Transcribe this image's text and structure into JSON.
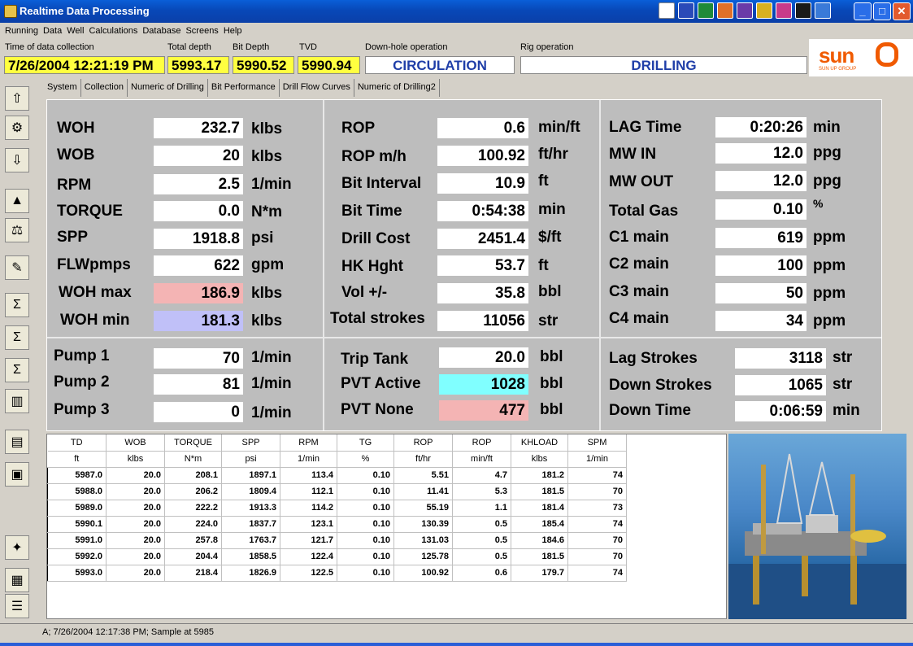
{
  "app": {
    "title": "Realtime Data Processing"
  },
  "menu": [
    "Running",
    "Data",
    "Well",
    "Calculations",
    "Database",
    "Screens",
    "Help"
  ],
  "header": {
    "time_label": "Time of data collection",
    "time_value": "7/26/2004 12:21:19 PM",
    "total_depth_label": "Total depth",
    "total_depth_value": "5993.17",
    "bit_depth_label": "Bit Depth",
    "bit_depth_value": "5990.52",
    "tvd_label": "TVD",
    "tvd_value": "5990.94",
    "downhole_label": "Down-hole operation",
    "downhole_value": "CIRCULATION",
    "rig_label": "Rig operation",
    "rig_value": "DRILLING"
  },
  "logo": {
    "text": "sun",
    "sub": "SUN UP GROUP"
  },
  "tabs": [
    "System",
    "Collection",
    "Numeric of Drilling",
    "Bit Performance",
    "Drill Flow Curves",
    "Numeric of Drilling2"
  ],
  "col1": [
    {
      "label": "WOH",
      "value": "232.7",
      "unit": "klbs"
    },
    {
      "label": "WOB",
      "value": "20",
      "unit": "klbs"
    },
    {
      "label": "RPM",
      "value": "2.5",
      "unit": "1/min"
    },
    {
      "label": "TORQUE",
      "value": "0.0",
      "unit": "N*m"
    },
    {
      "label": "SPP",
      "value": "1918.8",
      "unit": "psi"
    },
    {
      "label": "FLWpmps",
      "value": "622",
      "unit": "gpm"
    },
    {
      "label": "WOH max",
      "value": "186.9",
      "unit": "klbs"
    },
    {
      "label": "WOH min",
      "value": "181.3",
      "unit": "klbs"
    }
  ],
  "col2": [
    {
      "label": "ROP",
      "value": "0.6",
      "unit": "min/ft"
    },
    {
      "label": "ROP m/h",
      "value": "100.92",
      "unit": "ft/hr"
    },
    {
      "label": "Bit Interval",
      "value": "10.9",
      "unit": "ft"
    },
    {
      "label": "Bit Time",
      "value": "0:54:38",
      "unit": "min"
    },
    {
      "label": "Drill Cost",
      "value": "2451.4",
      "unit": "$/ft"
    },
    {
      "label": "HK Hght",
      "value": "53.7",
      "unit": "ft"
    },
    {
      "label": "Vol +/-",
      "value": "35.8",
      "unit": "bbl"
    },
    {
      "label": "Total strokes",
      "value": "11056",
      "unit": "str"
    }
  ],
  "col3": [
    {
      "label": "LAG Time",
      "value": "0:20:26",
      "unit": "min"
    },
    {
      "label": "MW IN",
      "value": "12.0",
      "unit": "ppg"
    },
    {
      "label": "MW OUT",
      "value": "12.0",
      "unit": "ppg"
    },
    {
      "label": "Total Gas",
      "value": "0.10",
      "unit": "%"
    },
    {
      "label": "C1 main",
      "value": "619",
      "unit": "ppm"
    },
    {
      "label": "C2 main",
      "value": "100",
      "unit": "ppm"
    },
    {
      "label": "C3 main",
      "value": "50",
      "unit": "ppm"
    },
    {
      "label": "C4 main",
      "value": "34",
      "unit": "ppm"
    }
  ],
  "pumps": [
    {
      "label": "Pump 1",
      "value": "70",
      "unit": "1/min"
    },
    {
      "label": "Pump 2",
      "value": "81",
      "unit": "1/min"
    },
    {
      "label": "Pump 3",
      "value": "0",
      "unit": "1/min"
    }
  ],
  "tanks": [
    {
      "label": "Trip Tank",
      "value": "20.0",
      "unit": "bbl"
    },
    {
      "label": "PVT Active",
      "value": "1028",
      "unit": "bbl"
    },
    {
      "label": "PVT None",
      "value": "477",
      "unit": "bbl"
    }
  ],
  "strokes": [
    {
      "label": "Lag Strokes",
      "value": "3118",
      "unit": "str"
    },
    {
      "label": "Down Strokes",
      "value": "1065",
      "unit": "str"
    },
    {
      "label": "Down Time",
      "value": "0:06:59",
      "unit": "min"
    }
  ],
  "table": {
    "headers": [
      "TD",
      "WOB",
      "TORQUE",
      "SPP",
      "RPM",
      "TG",
      "ROP",
      "ROP",
      "KHLOAD",
      "SPM"
    ],
    "units": [
      "ft",
      "klbs",
      "N*m",
      "psi",
      "1/min",
      "%",
      "ft/hr",
      "min/ft",
      "klbs",
      "1/min"
    ],
    "rows": [
      [
        "5987.0",
        "20.0",
        "208.1",
        "1897.1",
        "113.4",
        "0.10",
        "5.51",
        "4.7",
        "181.2",
        "74"
      ],
      [
        "5988.0",
        "20.0",
        "206.2",
        "1809.4",
        "112.1",
        "0.10",
        "11.41",
        "5.3",
        "181.5",
        "70"
      ],
      [
        "5989.0",
        "20.0",
        "222.2",
        "1913.3",
        "114.2",
        "0.10",
        "55.19",
        "1.1",
        "181.4",
        "73"
      ],
      [
        "5990.1",
        "20.0",
        "224.0",
        "1837.7",
        "123.1",
        "0.10",
        "130.39",
        "0.5",
        "185.4",
        "74"
      ],
      [
        "5991.0",
        "20.0",
        "257.8",
        "1763.7",
        "121.7",
        "0.10",
        "131.03",
        "0.5",
        "184.6",
        "70"
      ],
      [
        "5992.0",
        "20.0",
        "204.4",
        "1858.5",
        "122.4",
        "0.10",
        "125.78",
        "0.5",
        "181.5",
        "70"
      ],
      [
        "5993.0",
        "20.0",
        "218.4",
        "1826.9",
        "122.5",
        "0.10",
        "100.92",
        "0.6",
        "179.7",
        "74"
      ]
    ]
  },
  "status": "A; 7/26/2004 12:17:38 PM; Sample at 5985"
}
